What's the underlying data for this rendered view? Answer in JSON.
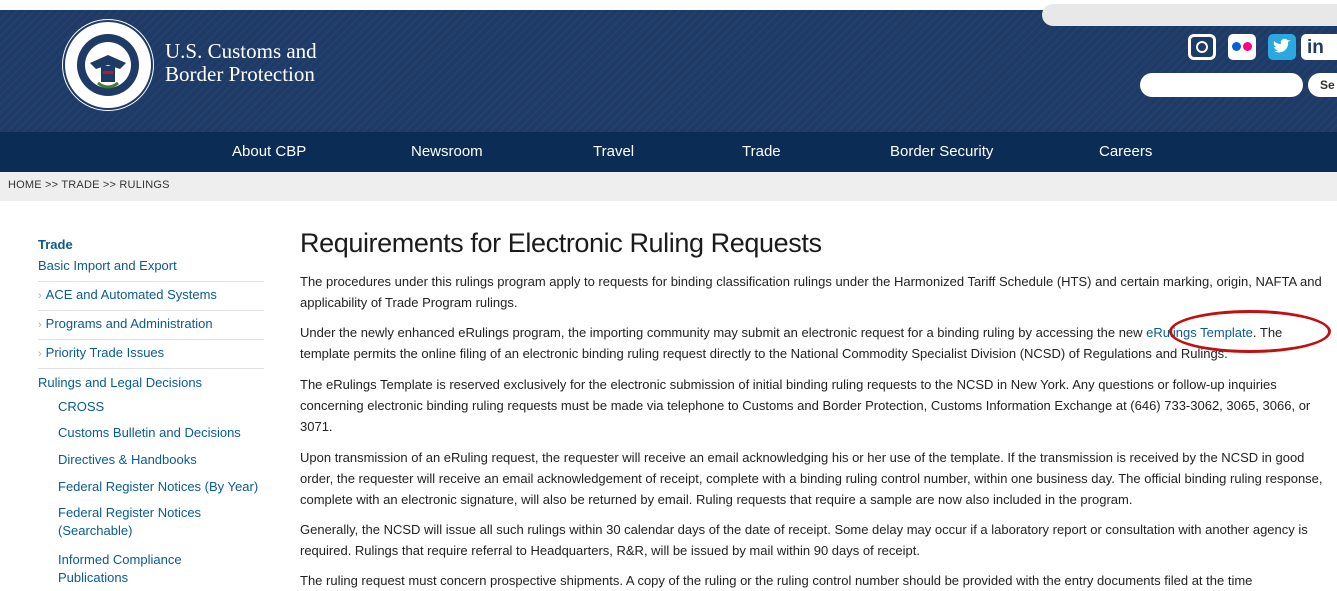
{
  "header": {
    "brand_line1": "U.S. Customs and",
    "brand_line2": "Border Protection",
    "search_button": "Se",
    "social": {
      "linkedin": "in"
    }
  },
  "nav": {
    "items": [
      "About CBP",
      "Newsroom",
      "Travel",
      "Trade",
      "Border Security",
      "Careers"
    ]
  },
  "breadcrumb": "HOME >> TRADE >> RULINGS",
  "sidebar": {
    "title": "Trade",
    "basic": "Basic Import and Export",
    "items": [
      "ACE and Automated Systems",
      "Programs and Administration",
      "Priority Trade Issues"
    ],
    "rulings": "Rulings and Legal Decisions",
    "sub": [
      "CROSS",
      "Customs Bulletin and Decisions",
      "Directives & Handbooks",
      "Federal Register Notices (By Year)",
      "Federal Register Notices",
      "(Searchable)",
      "Informed Compliance",
      "Publications"
    ]
  },
  "main": {
    "title": "Requirements for Electronic Ruling Requests",
    "p1": "The procedures under this rulings program apply to requests for binding classification rulings under the Harmonized Tariff Schedule (HTS) and certain marking, origin, NAFTA and applicability of Trade Program rulings.",
    "p2_before": "Under the newly enhanced eRulings program, the importing community may submit an electronic request for a binding ruling by accessing the new ",
    "p2_link": "eRulings Template",
    "p2_after": ". The template permits the online filing of an electronic binding ruling request directly to the National Commodity Specialist Division (NCSD) of Regulations and Rulings.",
    "p3": "The eRulings Template is reserved exclusively for the electronic submission of initial binding ruling requests to the NCSD in New York. Any questions or follow-up inquiries concerning electronic binding ruling requests must be made via telephone to Customs and Border Protection, Customs Information Exchange at (646) 733-3062, 3065, 3066, or 3071.",
    "p4": "Upon transmission of an eRuling request, the requester will receive an email acknowledging his or her use of the template. If the transmission is received by the NCSD in good order, the requester will receive an email acknowledgement of receipt, complete with a binding ruling control number, within one business day. The official binding ruling response, complete with an electronic signature, will also be returned by email. Ruling requests that require a sample are now also included in the program.",
    "p5": "Generally, the NCSD will issue all such rulings within 30 calendar days of the date of receipt. Some delay may occur if a laboratory report or consultation with another agency is required. Rulings that require referral to Headquarters, R&R, will be issued by mail within 90 days of receipt.",
    "p6": "The ruling request must concern prospective shipments. A copy of the ruling or the ruling control number should be provided with the entry documents filed at the time"
  },
  "colors": {
    "header": "#1e3a66",
    "nav": "#0b2c55",
    "link": "#0a5a92",
    "annotation": "#c01010"
  }
}
